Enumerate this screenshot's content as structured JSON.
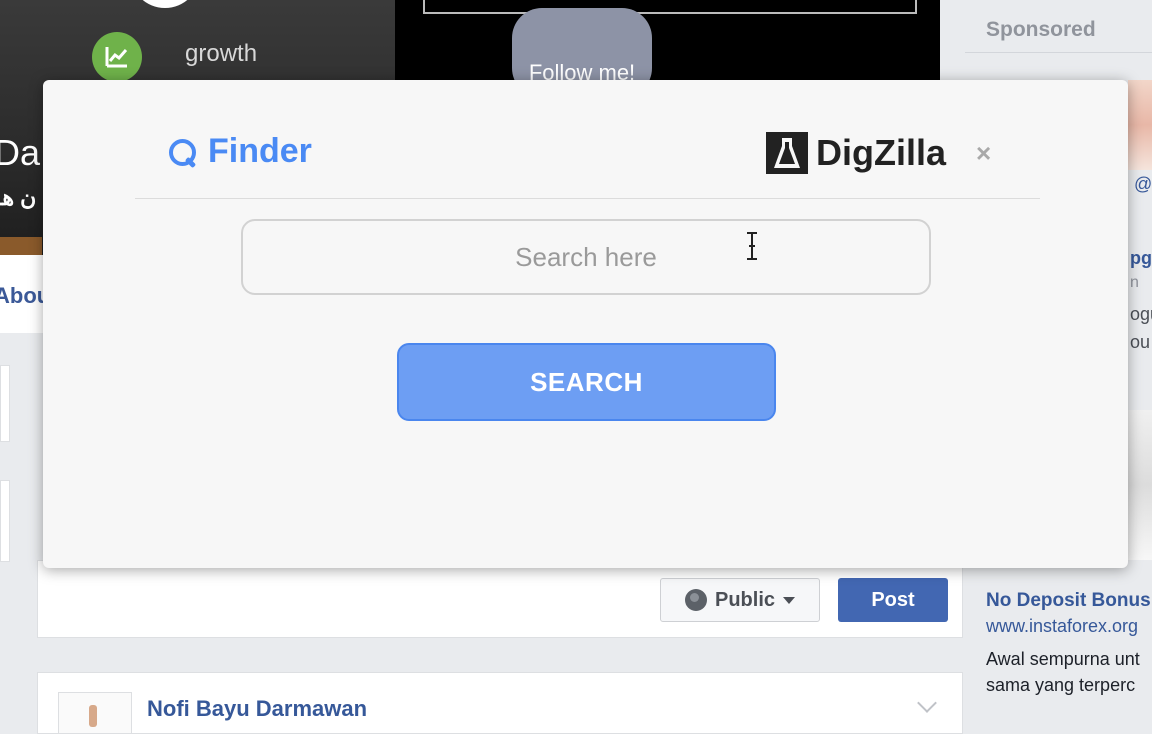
{
  "background": {
    "cover": {
      "growth_label": "growth",
      "follow_bubble": "Follow me!",
      "name_fragment": "Da",
      "sub_fragment": "ن هـ"
    },
    "about_label": "Abou",
    "composer": {
      "privacy_label": "Public",
      "post_label": "Post"
    },
    "feed_post": {
      "author": "Nofi Bayu Darmawan"
    },
    "right_column": {
      "sponsored_label": "Sponsored",
      "ad_fragments": [
        "@",
        "pg",
        "n",
        "ogu",
        "ou"
      ],
      "ad_title": "No Deposit Bonus",
      "ad_url": "www.instaforex.org",
      "ad_body_line1": "Awal sempurna unt",
      "ad_body_line2": "sama yang terperc"
    }
  },
  "finder_modal": {
    "title": "Finder",
    "brand": "DigZilla",
    "close_label": "×",
    "search": {
      "placeholder": "Search here",
      "value": ""
    },
    "search_button_label": "SEARCH"
  },
  "colors": {
    "finder_accent": "#4a8af4",
    "search_button_bg": "#6d9ef3",
    "facebook_blue": "#4267b2",
    "link_blue": "#365899",
    "growth_green": "#6fb24a"
  },
  "icons": {
    "finder": "search-icon",
    "brand": "digzilla-logo-icon",
    "close": "close-icon",
    "growth": "line-chart-icon",
    "privacy": "globe-icon",
    "privacy_dropdown": "caret-down-icon",
    "feed_menu": "chevron-down-icon",
    "cursor": "text-cursor-icon"
  }
}
